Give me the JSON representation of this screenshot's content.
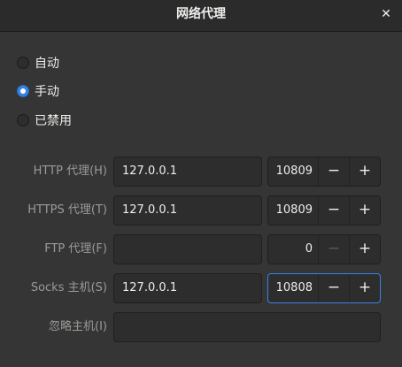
{
  "window": {
    "title": "网络代理",
    "close_glyph": "✕"
  },
  "modes": [
    {
      "label": "自动",
      "checked": false
    },
    {
      "label": "手动",
      "checked": true
    },
    {
      "label": "已禁用",
      "checked": false
    }
  ],
  "proxies": [
    {
      "label": "HTTP 代理(H)",
      "host": "127.0.0.1",
      "port": "10809",
      "minus_enabled": true
    },
    {
      "label": "HTTPS 代理(T)",
      "host": "127.0.0.1",
      "port": "10809",
      "minus_enabled": true
    },
    {
      "label": "FTP 代理(F)",
      "host": "",
      "port": "0",
      "minus_enabled": false
    },
    {
      "label": "Socks 主机(S)",
      "host": "127.0.0.1",
      "port": "10808",
      "minus_enabled": true,
      "focused": true
    }
  ],
  "ignore_hosts": {
    "label": "忽略主机(I)",
    "value": ""
  },
  "glyphs": {
    "minus": "−",
    "plus": "+"
  },
  "colors": {
    "accent": "#3584e4",
    "background": "#353535",
    "field": "#2d2d2d"
  }
}
